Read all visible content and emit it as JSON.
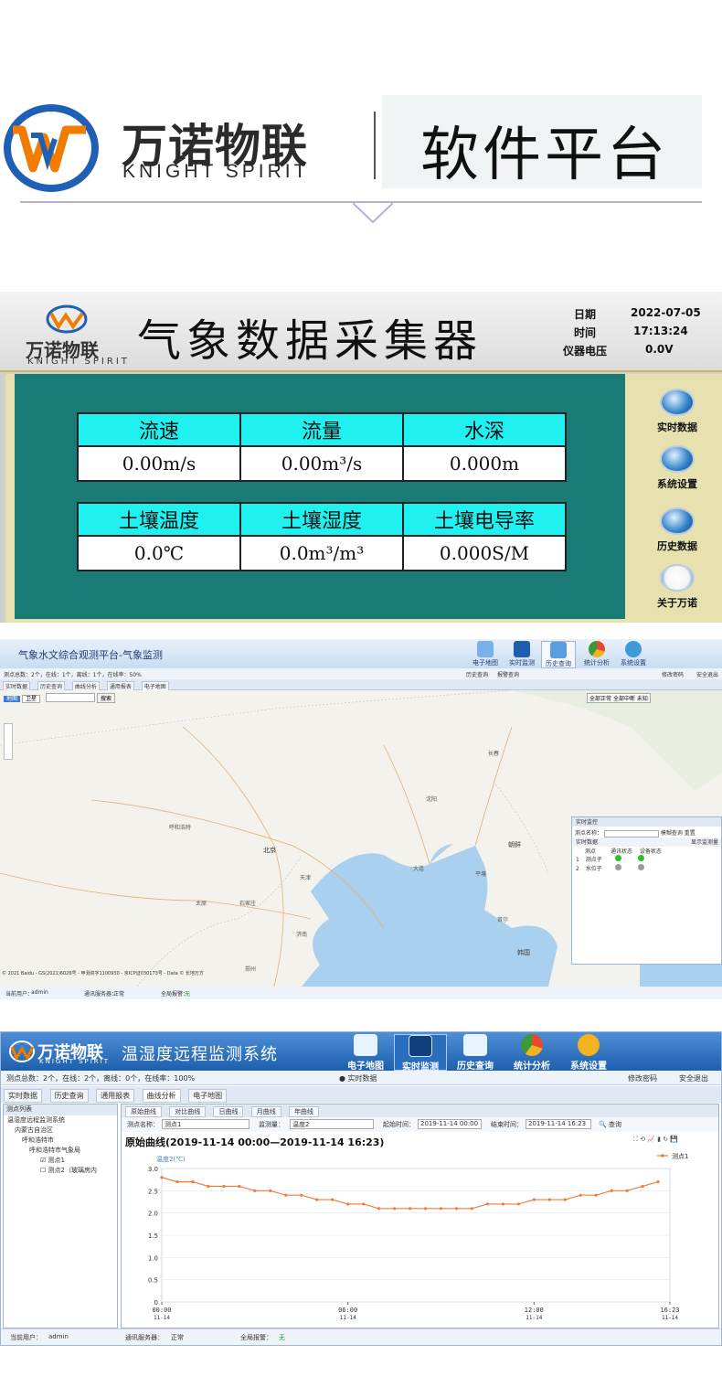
{
  "brand": {
    "name_cn": "万诺物联",
    "name_en": "KNIGHT SPIRIT",
    "tagline": "软件平台",
    "colors": {
      "logo_blue": "#1f5fb4",
      "logo_orange": "#f07c00",
      "rule": "#b8b0cf"
    }
  },
  "collector": {
    "logo_cn": "万诺物联",
    "logo_en": "KNIGHT SPIRIT",
    "title": "气象数据采集器",
    "info": [
      {
        "label": "日期",
        "value": "2022-07-05"
      },
      {
        "label": "时间",
        "value": "17:13:24"
      },
      {
        "label": "仪器电压",
        "value": "0.0V"
      }
    ],
    "group1_headers": [
      "流速",
      "流量",
      "水深"
    ],
    "group1_values": [
      "0.00m/s",
      "0.00m³/s",
      "0.000m"
    ],
    "group2_headers": [
      "土壤温度",
      "土壤湿度",
      "土壤电导率"
    ],
    "group2_values": [
      "0.0℃",
      "0.0m³/m³",
      "0.000S/M"
    ],
    "side_buttons": [
      {
        "label": "实时数据",
        "icon": "magnifier-icon"
      },
      {
        "label": "系统设置",
        "icon": "gears-icon"
      },
      {
        "label": "历史数据",
        "icon": "save-disk-icon"
      },
      {
        "label": "关于万诺",
        "icon": "brand-logo-icon"
      }
    ],
    "colors": {
      "panel": "#1a7a76",
      "header_cell": "#1ff0f0",
      "frame": "#e7e1b0"
    }
  },
  "mapapp": {
    "title": "气象水文综合观测平台-气象监测",
    "nav": [
      {
        "label": "电子地图",
        "icon": "map-icon"
      },
      {
        "label": "实时监测",
        "icon": "monitor-icon"
      },
      {
        "label": "历史查询",
        "icon": "history-icon"
      },
      {
        "label": "统计分析",
        "icon": "pie-chart-icon"
      },
      {
        "label": "系统设置",
        "icon": "gears-icon"
      }
    ],
    "summary": "测点总数：2个，在线：1个，离线：1个，在线率：50%",
    "sub_links": [
      "历史查询",
      "报警查询"
    ],
    "account_links": [
      "修改密码",
      "安全退出"
    ],
    "tabs": [
      "实时数据",
      "历史查询",
      "曲线分析",
      "通用报表",
      "电子地图"
    ],
    "map_controls": [
      "地图",
      "卫星",
      "搜索"
    ],
    "legend": [
      "全部正常",
      "全部中断",
      "未知"
    ],
    "cities": [
      {
        "name": "呼和浩特"
      },
      {
        "name": "北京"
      },
      {
        "name": "天津"
      },
      {
        "name": "太原"
      },
      {
        "name": "石家庄"
      },
      {
        "name": "济南"
      },
      {
        "name": "沈阳"
      },
      {
        "name": "长春"
      },
      {
        "name": "大连"
      },
      {
        "name": "平壤"
      },
      {
        "name": "首尔"
      },
      {
        "name": "朝鲜"
      },
      {
        "name": "韩国"
      },
      {
        "name": "郑州"
      }
    ],
    "realtime": {
      "title": "实时监控",
      "search_label": "测点名称：",
      "search_button": "模糊查询",
      "reset_button": "重置",
      "section": "实时数据",
      "show_checkbox": "显示监测量",
      "columns": [
        "测点",
        "通讯状态",
        "设备状态"
      ],
      "rows": [
        {
          "no": "1",
          "name": "测点子",
          "comm": "#22c322",
          "dev": "#22c322"
        },
        {
          "no": "2",
          "name": "水位子",
          "comm": "#9a9a9a",
          "dev": "#9a9a9a"
        }
      ]
    },
    "copyright": "© 2021 Baidu - GS(2021)6026号 - 甲测资字1100930 - 京ICP证030173号 - Data © 长地万方",
    "status": [
      {
        "label": "当前用户：",
        "value": "admin"
      },
      {
        "label": "通讯服务器：",
        "value": "正常"
      },
      {
        "label": "全局报警：",
        "value": "无"
      }
    ]
  },
  "curveapp": {
    "logo_cn": "万诺物联",
    "logo_en": "KNIGHT SPIRIT",
    "system_title": "温湿度远程监测系统",
    "nav": [
      {
        "label": "电子地图",
        "icon": "map-icon",
        "active": false
      },
      {
        "label": "实时监测",
        "icon": "monitor-icon",
        "active": true
      },
      {
        "label": "历史查询",
        "icon": "history-icon",
        "active": false
      },
      {
        "label": "统计分析",
        "icon": "pie-chart-icon",
        "active": false
      },
      {
        "label": "系统设置",
        "icon": "gears-icon",
        "active": false
      }
    ],
    "summary": "测点总数：2个，在线：2个，离线：0个，在线率：100%",
    "sub_link": "实时数据",
    "account_links": [
      "修改密码",
      "安全退出"
    ],
    "tabs": [
      "实时数据",
      "历史查询",
      "通用报表",
      "曲线分析",
      "电子地图"
    ],
    "tree_title": "测点列表",
    "tree": [
      "温湿度远程监测系统",
      "内蒙古自治区",
      "呼和浩特市",
      "呼和浩特市气象局",
      "测点1",
      "测点2（玻璃房内"
    ],
    "curve_tabs": [
      "原始曲线",
      "对比曲线",
      "日曲线",
      "月曲线",
      "年曲线"
    ],
    "filter": {
      "point_label": "测点名称：",
      "point_value": "测点1",
      "metric_label": "监测量：",
      "metric_value": "温度2",
      "start_label": "起始时间：",
      "start_value": "2019-11-14 00:00",
      "end_label": "结束时间：",
      "end_value": "2019-11-14 16:23",
      "query": "查询"
    },
    "chart_heading": "原始曲线(2019-11-14 00:00—2019-11-14 16:23)",
    "status": [
      {
        "label": "当前用户：",
        "value": "admin"
      },
      {
        "label": "通讯服务器：",
        "value": "正常"
      },
      {
        "label": "全局报警：",
        "value": "无"
      }
    ]
  },
  "chart_data": {
    "type": "line",
    "title": "",
    "ylabel": "温度2(℃)",
    "xlabel": "",
    "ylim": [
      0,
      3.0
    ],
    "yticks": [
      "0",
      "0.5",
      "1.0",
      "1.5",
      "2.0",
      "2.5",
      "3.0"
    ],
    "xticks": [
      {
        "time": "00:00",
        "date": "11-14",
        "h": 0
      },
      {
        "time": "06:00",
        "date": "11-14",
        "h": 6
      },
      {
        "time": "12:00",
        "date": "11-14",
        "h": 12
      },
      {
        "time": "16:23",
        "date": "11-14",
        "h": 16.38
      }
    ],
    "grid": true,
    "legend": "top-right",
    "series": [
      {
        "name": "测点1",
        "color": "#f07c3c",
        "x": [
          0,
          0.5,
          1,
          1.5,
          2,
          2.5,
          3,
          3.5,
          4,
          4.5,
          5,
          5.5,
          6,
          6.5,
          7,
          7.5,
          8,
          8.5,
          9,
          9.5,
          10,
          10.5,
          11,
          11.5,
          12,
          12.5,
          13,
          13.5,
          14,
          14.5,
          15,
          15.5,
          16
        ],
        "values": [
          2.8,
          2.7,
          2.7,
          2.6,
          2.6,
          2.6,
          2.5,
          2.5,
          2.4,
          2.4,
          2.3,
          2.3,
          2.2,
          2.2,
          2.1,
          2.1,
          2.1,
          2.1,
          2.1,
          2.1,
          2.1,
          2.2,
          2.2,
          2.2,
          2.3,
          2.3,
          2.3,
          2.4,
          2.4,
          2.5,
          2.5,
          2.6,
          2.7
        ]
      }
    ]
  }
}
